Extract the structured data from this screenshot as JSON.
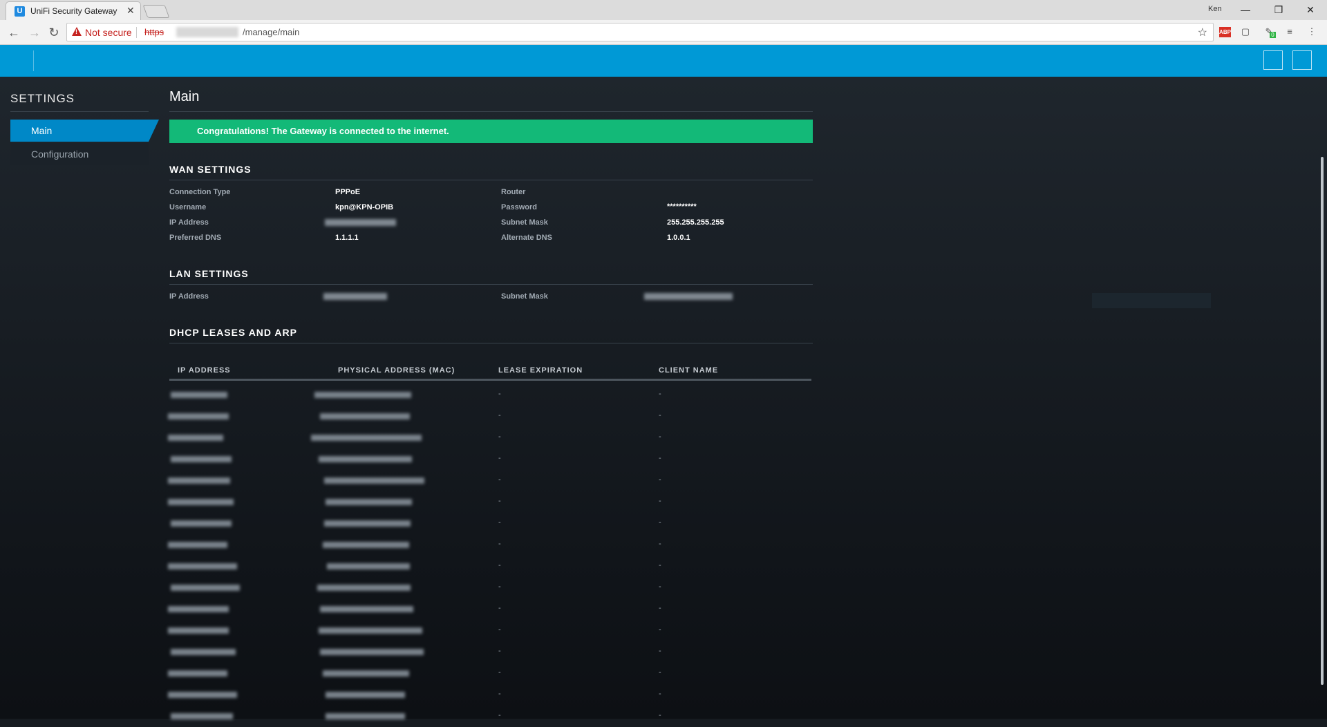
{
  "browser": {
    "tab_title": "UniFi Security Gateway",
    "tab_favicon": "U",
    "tab_close": "✕",
    "profile": "Ken",
    "not_secure": "Not secure",
    "url_scheme": "https",
    "url_path": "/manage/main",
    "ext_badge": "0",
    "ext_red_label": "ABP"
  },
  "sidebar": {
    "title": "SETTINGS",
    "items": [
      {
        "label": "Main",
        "active": true
      },
      {
        "label": "Configuration",
        "active": false
      }
    ]
  },
  "main": {
    "title": "Main",
    "banner": "Congratulations! The Gateway is connected to the internet.",
    "wan": {
      "heading": "WAN SETTINGS",
      "connection_type_label": "Connection Type",
      "connection_type": "PPPoE",
      "router_label": "Router",
      "username_label": "Username",
      "username": "kpn@KPN-OPIB",
      "password_label": "Password",
      "password": "**********",
      "ip_label": "IP Address",
      "subnet_label": "Subnet Mask",
      "subnet": "255.255.255.255",
      "preferred_dns_label": "Preferred DNS",
      "preferred_dns": "1.1.1.1",
      "alternate_dns_label": "Alternate DNS",
      "alternate_dns": "1.0.0.1"
    },
    "lan": {
      "heading": "LAN SETTINGS",
      "ip_label": "IP Address",
      "subnet_label": "Subnet Mask"
    },
    "dhcp": {
      "heading": "DHCP LEASES AND ARP",
      "columns": [
        "IP ADDRESS",
        "PHYSICAL ADDRESS (MAC)",
        "LEASE EXPIRATION",
        "CLIENT NAME"
      ],
      "empty_value": "-",
      "row_count": 16
    }
  },
  "colors": {
    "header": "#0099d6",
    "accent": "#0088c7",
    "success": "#13b978",
    "background": "#161b20"
  },
  "icons": {
    "back": "back-arrow-icon",
    "forward": "forward-arrow-icon",
    "reload": "reload-icon",
    "bookmark": "star-icon",
    "menu": "kebab-menu-icon"
  }
}
